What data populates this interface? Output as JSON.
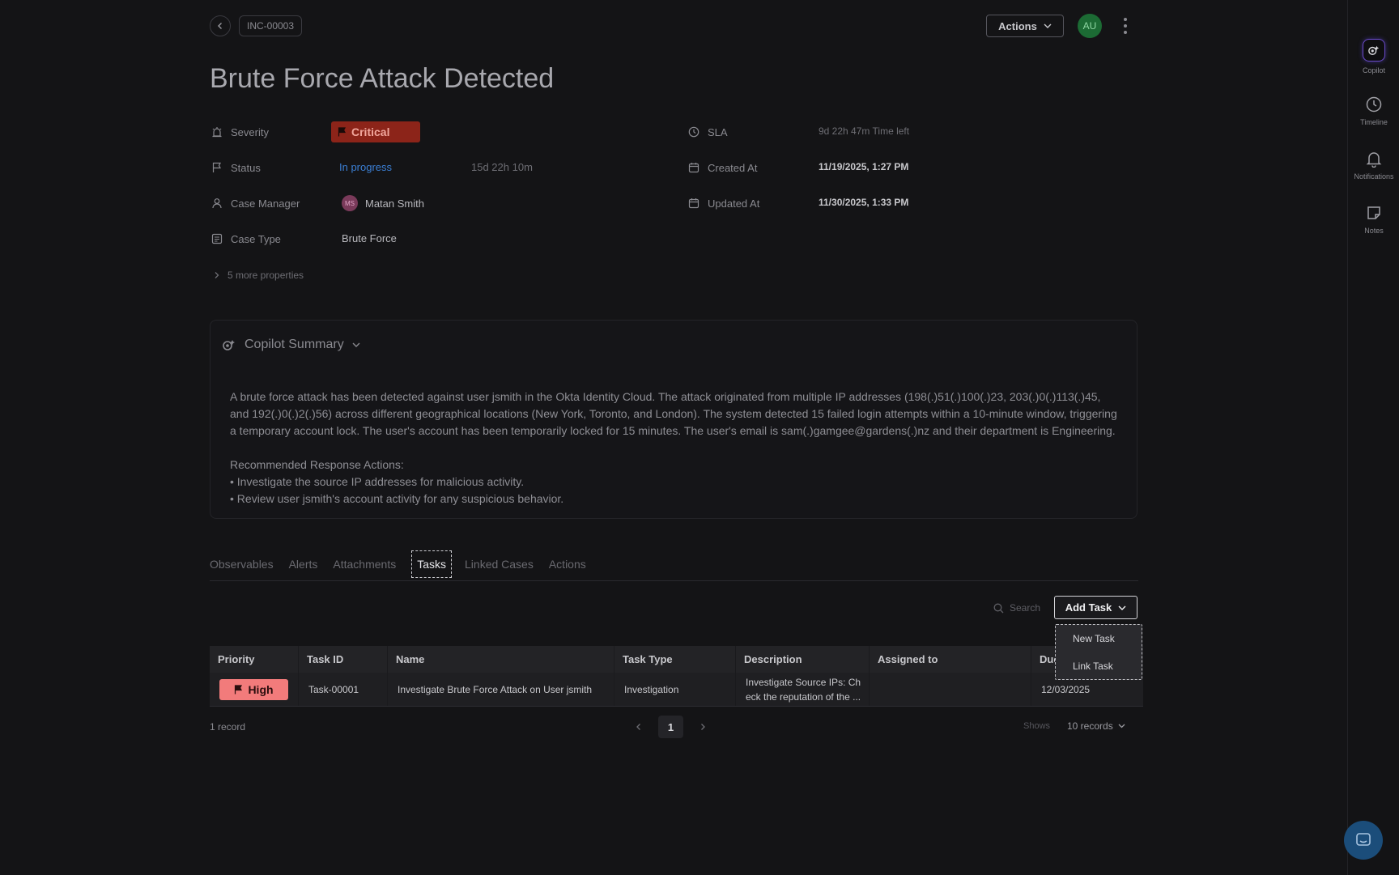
{
  "header": {
    "case_id": "INC-00003",
    "actions_label": "Actions",
    "user_initials": "AU"
  },
  "title": "Brute Force Attack Detected",
  "properties": {
    "severity": {
      "label": "Severity",
      "value": "Critical"
    },
    "status": {
      "label": "Status",
      "value": "In progress",
      "duration": "15d 22h 10m"
    },
    "case_manager": {
      "label": "Case Manager",
      "initials": "MS",
      "value": "Matan Smith"
    },
    "case_type": {
      "label": "Case Type",
      "value": "Brute Force"
    },
    "sla": {
      "label": "SLA",
      "value": "9d 22h 47m",
      "suffix": "Time left"
    },
    "created_at": {
      "label": "Created At",
      "value": "11/19/2025, 1:27 PM"
    },
    "updated_at": {
      "label": "Updated At",
      "value": "11/30/2025, 1:33 PM"
    },
    "more": "5 more properties"
  },
  "copilot": {
    "title": "Copilot Summary",
    "paragraph": "A brute force attack has been detected against user jsmith in the Okta Identity Cloud. The attack originated from multiple IP addresses (198(.)51(.)100(.)23, 203(.)0(.)113(.)45, and 192(.)0(.)2(.)56) across different geographical locations (New York, Toronto, and London). The system detected 15 failed login attempts within a 10-minute window, triggering a temporary account lock. The user's account has been temporarily locked for 15 minutes. The user's email is sam(.)gamgee@gardens(.)nz and their department is Engineering.",
    "actions_heading": "Recommended Response Actions:",
    "bullet_1": "• Investigate the source IP addresses for malicious activity.",
    "bullet_2": "• Review user jsmith's account activity for any suspicious behavior."
  },
  "tabs": {
    "observables": "Observables",
    "alerts": "Alerts",
    "attachments": "Attachments",
    "tasks": "Tasks",
    "linked_cases": "Linked Cases",
    "actions": "Actions"
  },
  "toolbar": {
    "search_placeholder": "Search",
    "add_task_label": "Add Task",
    "menu_new_task": "New Task",
    "menu_link_task": "Link Task"
  },
  "table": {
    "headers": {
      "priority": "Priority",
      "task_id": "Task ID",
      "name": "Name",
      "task_type": "Task Type",
      "description": "Description",
      "assigned_to": "Assigned to",
      "due": "Due"
    },
    "rows": [
      {
        "priority": "High",
        "task_id": "Task-00001",
        "name": "Investigate Brute Force Attack on User jsmith",
        "task_type": "Investigation",
        "description_line1": "Investigate Source IPs: Ch",
        "description_line2": "eck the reputation of the ...",
        "assigned_to": "",
        "due": "12/03/2025"
      }
    ]
  },
  "footer": {
    "records": "1 record",
    "page": "1",
    "shows_label": "Shows",
    "per_page": "10 records"
  },
  "rail": {
    "copilot": "Copilot",
    "timeline": "Timeline",
    "notifications": "Notifications",
    "notes": "Notes"
  },
  "colors": {
    "critical": "#8c2419",
    "high": "#f27b7b",
    "status_link": "#3b7fd4",
    "avatar_au": "#1c6b34"
  }
}
